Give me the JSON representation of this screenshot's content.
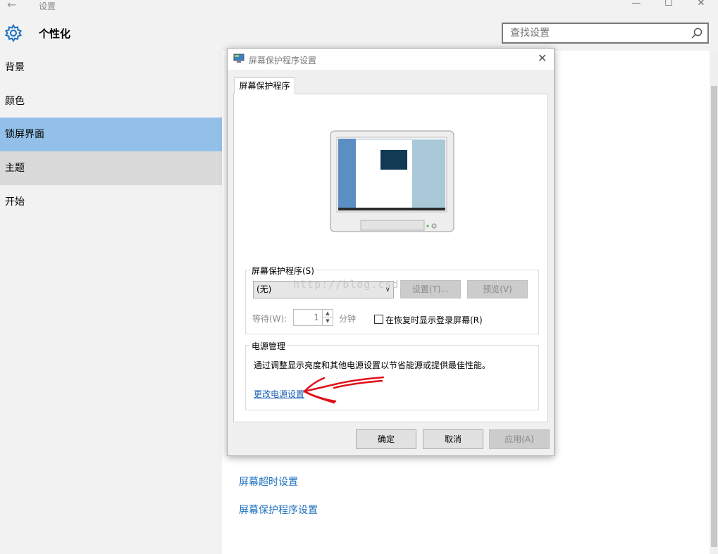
{
  "window": {
    "back_glyph": "←",
    "title": "设置",
    "controls": {
      "minimize": "—",
      "maximize": "☐",
      "close": "✕"
    }
  },
  "header": {
    "title": "个性化",
    "search_placeholder": "查找设置"
  },
  "sidebar": {
    "items": [
      {
        "label": "背景"
      },
      {
        "label": "颜色"
      },
      {
        "label": "锁屏界面",
        "selected": true
      },
      {
        "label": "主题"
      },
      {
        "label": "开始"
      }
    ]
  },
  "main": {
    "links": [
      "屏幕超时设置",
      "屏幕保护程序设置"
    ]
  },
  "dialog": {
    "title": "屏幕保护程序设置",
    "close_glyph": "✕",
    "tab": "屏幕保护程序",
    "screensaver": {
      "group_label": "屏幕保护程序(S)",
      "selected_value": "(无)",
      "dropdown_glyph": "∨",
      "settings_button": "设置(T)...",
      "preview_button": "预览(V)",
      "wait_label": "等待(W):",
      "wait_value": "1",
      "wait_unit": "分钟",
      "resume_checkbox_label": "在恢复时显示登录屏幕(R)",
      "resume_checked": false
    },
    "power": {
      "group_label": "电源管理",
      "description": "通过调整显示亮度和其他电源设置以节省能源或提供最佳性能。",
      "link": "更改电源设置"
    },
    "buttons": {
      "ok": "确定",
      "cancel": "取消",
      "apply": "应用(A)"
    }
  },
  "watermark": "http://blog.csdn",
  "colors": {
    "accent": "#1a6fbf",
    "selected_nav": "#92c0e8",
    "annotation_arrow": "#e0101a"
  },
  "icons": [
    "settings-gear-icon",
    "search-icon",
    "display-icon",
    "monitor-preview-icon",
    "back-arrow-icon"
  ]
}
